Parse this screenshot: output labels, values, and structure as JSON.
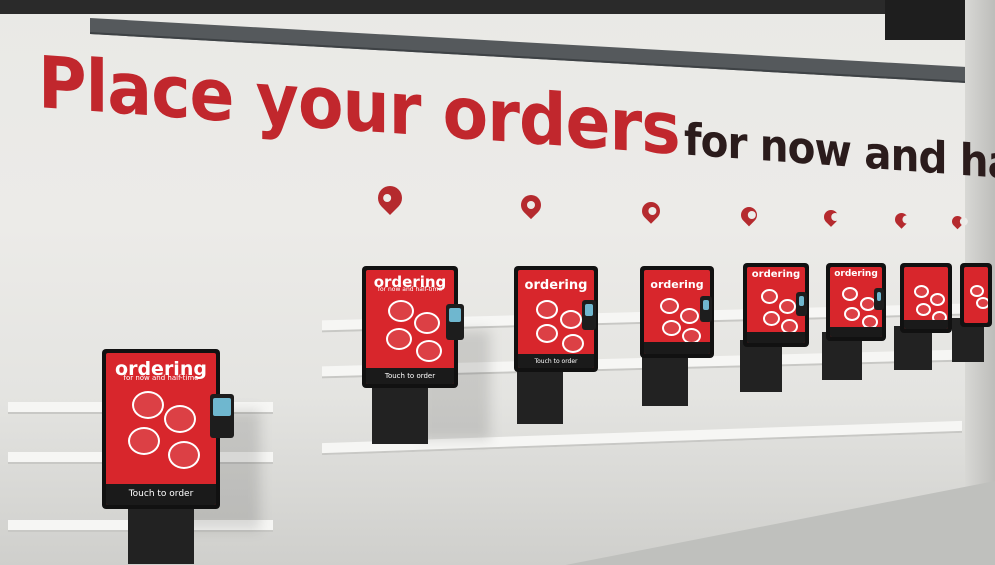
{
  "wall": {
    "headline_red": "Place your orders",
    "headline_dark": "for now and half-time"
  },
  "kiosk": {
    "screen_title": "ordering",
    "screen_subtitle": "for now and half-time",
    "screen_footer": "Touch to order"
  },
  "colors": {
    "brand_red": "#c1272d",
    "screen_red": "#d8262c",
    "wall": "#ecebe8",
    "kiosk_body": "#222222"
  },
  "counts": {
    "kiosks": 8,
    "location_pins": 7
  }
}
